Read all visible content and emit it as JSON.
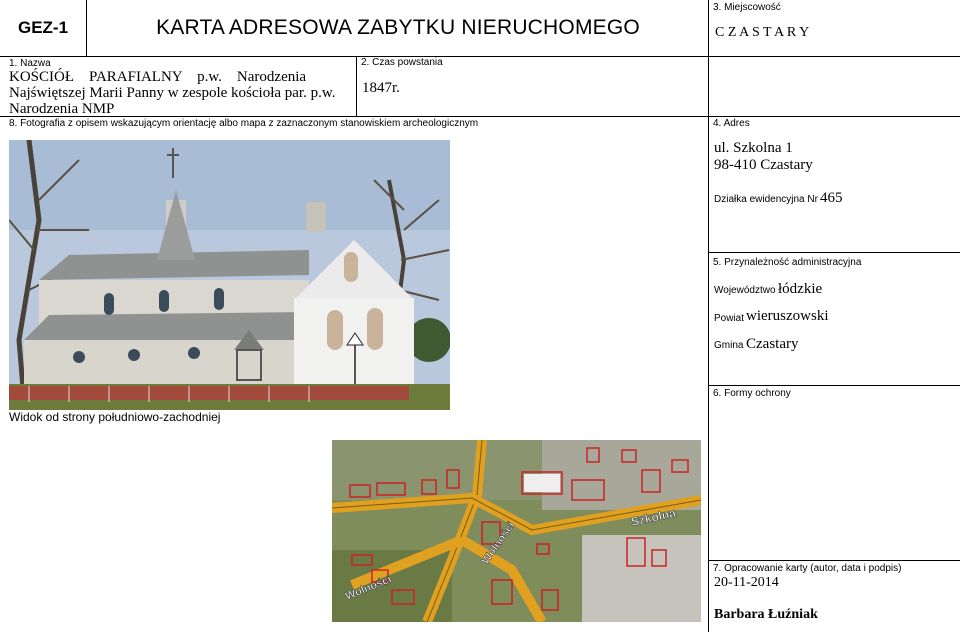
{
  "header": {
    "code": "GEZ-1",
    "title": "KARTA ADRESOWA ZABYTKU NIERUCHOMEGO"
  },
  "fields": {
    "f1_label": "1. Nazwa",
    "name_line1": "KOŚCIÓŁ    PARAFIALNY    p.w.    Narodzenia",
    "name_line2": "Najświętszej Marii Panny w zespole kościoła par. p.w.",
    "name_line3": "Narodzenia NMP",
    "f2_label": "2. Czas powstania",
    "date_value": "1847r.",
    "f3_label": "3. Miejscowość",
    "locality_value": "C Z A S T A R Y",
    "f4_label": "4. Adres",
    "address_line1": "ul. Szkolna 1",
    "address_line2": "98-410 Czastary",
    "parcel_label": "Działka ewidencyjna Nr",
    "parcel_value": "465",
    "f5_label": "5. Przynależność administracyjna",
    "voivodeship_label": "Województwo",
    "voivodeship_value": "łódzkie",
    "county_label": "Powiat",
    "county_value": "wieruszowski",
    "commune_label": "Gmina",
    "commune_value": "Czastary",
    "f6_label": "6. Formy ochrony",
    "f7_label": "7. Opracowanie karty (autor, data i podpis)",
    "prep_date": "20-11-2014",
    "prep_author": "Barbara Łuźniak",
    "f8_label": "8. Fotografia z opisem wskazującym orientację albo mapa z zaznaczonym stanowiskiem archeologicznym",
    "photo_caption": "Widok od strony południowo-zachodniej"
  },
  "map_labels": {
    "road_szkolna": "Szkolna",
    "road_wolnosci": "Wolności",
    "road_wolnosci2": "Wolności"
  },
  "colors": {
    "sky": "#b9c8dd",
    "wall": "#d9d7cf",
    "roof": "#8f9290",
    "grass": "#6d7c3a",
    "road": "#e0a020",
    "parcel_line": "#cc2222"
  }
}
